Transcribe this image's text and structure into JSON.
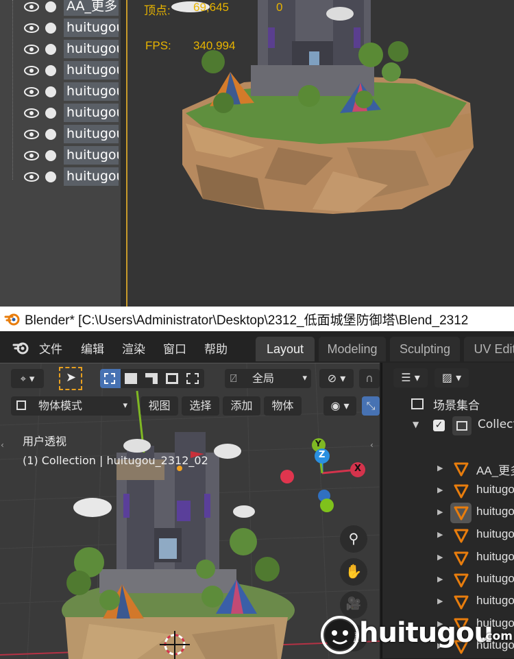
{
  "top_panel": {
    "scene_items": [
      "AA_更多",
      "huitugou",
      "huitugou",
      "huitugou",
      "huitugou",
      "huitugou",
      "huitugou",
      "huitugou",
      "huitugou"
    ],
    "stats": {
      "vertices_label": "顶点:",
      "vertices_value": "69,645",
      "vertices_selected": "0",
      "fps_label": "FPS:",
      "fps_value": "340.994"
    }
  },
  "title_bar": {
    "title": "Blender* [C:\\Users\\Administrator\\Desktop\\2312_低面城堡防御塔\\Blend_2312"
  },
  "blender": {
    "menu": [
      "文件",
      "编辑",
      "渲染",
      "窗口",
      "帮助"
    ],
    "workspaces": [
      "Layout",
      "Modeling",
      "Sculpting",
      "UV Edit"
    ],
    "active_workspace": "Layout",
    "header": {
      "transform_orientation": "全局",
      "mode": "物体模式",
      "menus": [
        "视图",
        "选择",
        "添加",
        "物体"
      ]
    },
    "viewport": {
      "view_name": "用户透视",
      "context": "(1) Collection | huitugou_2312_02",
      "axes": [
        "X",
        "Y",
        "Z"
      ]
    },
    "outliner": {
      "scene_collection": "场景集合",
      "collection": "Collection",
      "items": [
        "AA_更多",
        "huitugou",
        "huitugou",
        "huitugou",
        "huitugou",
        "huitugou",
        "huitugou",
        "huitugou",
        "huitugou"
      ]
    }
  },
  "watermark": {
    "text": "huitugou",
    "suffix": ".com"
  },
  "colors": {
    "accent_orange": "#e87d0d",
    "stat_yellow": "#e8b400",
    "axis_x": "#d4334c",
    "axis_y": "#7fb823",
    "axis_z": "#2a8fe0",
    "header_blue": "#4772b3"
  }
}
